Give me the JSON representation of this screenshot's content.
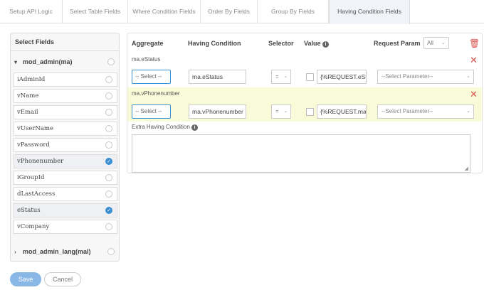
{
  "tabs": [
    {
      "label": "Setup API Logic"
    },
    {
      "label": "Select Table Fields"
    },
    {
      "label": "Where Condition Fields"
    },
    {
      "label": "Order By Fields"
    },
    {
      "label": "Group By Fields"
    },
    {
      "label": "Having Condition Fields",
      "active": true
    }
  ],
  "left": {
    "title": "Select Fields",
    "table1": {
      "name": "mod_admin(ma)",
      "expanded": true
    },
    "fields": [
      {
        "label": "iAdminId",
        "selected": false
      },
      {
        "label": "vName",
        "selected": false
      },
      {
        "label": "vEmail",
        "selected": false
      },
      {
        "label": "vUserName",
        "selected": false
      },
      {
        "label": "vPassword",
        "selected": false
      },
      {
        "label": "vPhonenumber",
        "selected": true
      },
      {
        "label": "iGroupId",
        "selected": false
      },
      {
        "label": "dLastAccess",
        "selected": false
      },
      {
        "label": "eStatus",
        "selected": true
      },
      {
        "label": "vCompany",
        "selected": false
      }
    ],
    "table2": {
      "name": "mod_admin_lang(mal)",
      "expanded": false
    }
  },
  "header": {
    "aggregate": "Aggregate",
    "having_condition": "Having Condition",
    "selector": "Selector",
    "value": "Value",
    "request_param": "Request Param",
    "all_select": "All"
  },
  "conditions": [
    {
      "label": "ma.eStatus",
      "aggregate": "-- Select --",
      "field": "ma.eStatus",
      "selector": "=",
      "value": "{%REQUEST.eStatus%}",
      "param": "--Select Parameter--",
      "highlighted": false
    },
    {
      "label": "ma.vPhonenumber",
      "aggregate": "-- Select --",
      "field": "ma.vPhonenumber",
      "selector": "=",
      "value": "{%REQUEST.ma.vPhonenumber%}",
      "param": "--Select Parameter--",
      "highlighted": true
    }
  ],
  "extra": {
    "label": "Extra Having Condition",
    "value": ""
  },
  "actions": {
    "save": "Save",
    "cancel": "Cancel"
  },
  "colors": {
    "accent": "#3b8fd1",
    "danger": "#d9534f",
    "highlight": "#f9fad8",
    "save_button": "#8ab8e6"
  },
  "icons": {
    "info": "info-icon",
    "trash": "trash-icon",
    "close": "close-icon",
    "check": "check-icon"
  }
}
